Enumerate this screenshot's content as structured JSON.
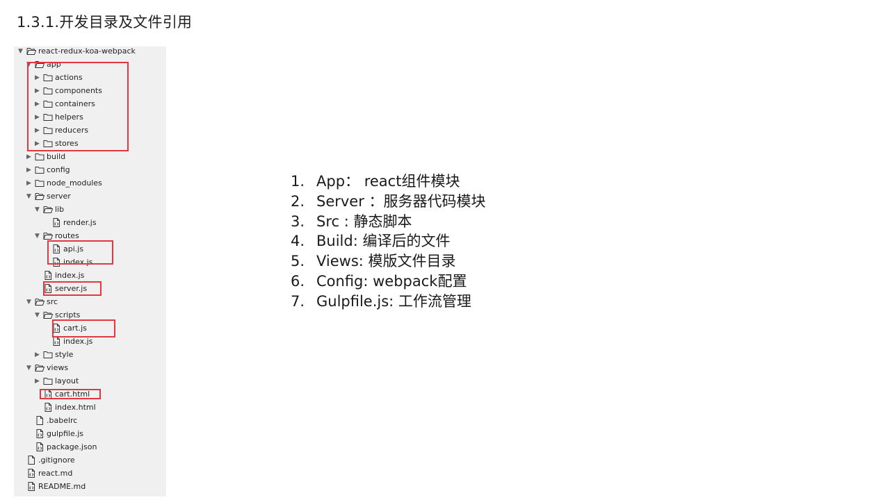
{
  "heading": "1.3.1.开发目录及文件引用",
  "tree": [
    {
      "label": "react-redux-koa-webpack",
      "type": "folder",
      "state": "open",
      "depth": 0
    },
    {
      "label": "app",
      "type": "folder",
      "state": "open",
      "depth": 1
    },
    {
      "label": "actions",
      "type": "folder",
      "state": "closed",
      "depth": 2
    },
    {
      "label": "components",
      "type": "folder",
      "state": "closed",
      "depth": 2
    },
    {
      "label": "containers",
      "type": "folder",
      "state": "closed",
      "depth": 2
    },
    {
      "label": "helpers",
      "type": "folder",
      "state": "closed",
      "depth": 2
    },
    {
      "label": "reducers",
      "type": "folder",
      "state": "closed",
      "depth": 2
    },
    {
      "label": "stores",
      "type": "folder",
      "state": "closed",
      "depth": 2
    },
    {
      "label": "build",
      "type": "folder",
      "state": "closed",
      "depth": 1
    },
    {
      "label": "config",
      "type": "folder",
      "state": "closed",
      "depth": 1
    },
    {
      "label": "node_modules",
      "type": "folder",
      "state": "closed",
      "depth": 1
    },
    {
      "label": "server",
      "type": "folder",
      "state": "open",
      "depth": 1
    },
    {
      "label": "lib",
      "type": "folder",
      "state": "open",
      "depth": 2
    },
    {
      "label": "render.js",
      "type": "code",
      "depth": 3
    },
    {
      "label": "routes",
      "type": "folder",
      "state": "open",
      "depth": 2
    },
    {
      "label": "api.js",
      "type": "code",
      "depth": 3
    },
    {
      "label": "index.js",
      "type": "code",
      "depth": 3
    },
    {
      "label": "index.js",
      "type": "code",
      "depth": 2
    },
    {
      "label": "server.js",
      "type": "code",
      "depth": 2
    },
    {
      "label": "src",
      "type": "folder",
      "state": "open",
      "depth": 1
    },
    {
      "label": "scripts",
      "type": "folder",
      "state": "open",
      "depth": 2
    },
    {
      "label": "cart.js",
      "type": "code",
      "depth": 3
    },
    {
      "label": "index.js",
      "type": "code",
      "depth": 3
    },
    {
      "label": "style",
      "type": "folder",
      "state": "closed",
      "depth": 2
    },
    {
      "label": "views",
      "type": "folder",
      "state": "open",
      "depth": 1
    },
    {
      "label": "layout",
      "type": "folder",
      "state": "closed",
      "depth": 2
    },
    {
      "label": "cart.html",
      "type": "code",
      "depth": 2
    },
    {
      "label": "index.html",
      "type": "code",
      "depth": 2
    },
    {
      "label": ".babelrc",
      "type": "file",
      "depth": 1
    },
    {
      "label": "gulpfile.js",
      "type": "code",
      "depth": 1
    },
    {
      "label": "package.json",
      "type": "code",
      "depth": 1
    },
    {
      "label": ".gitignore",
      "type": "file",
      "depth": 0
    },
    {
      "label": "react.md",
      "type": "code",
      "depth": 0
    },
    {
      "label": "README.md",
      "type": "code",
      "depth": 0
    }
  ],
  "highlight_color": "#e0383e",
  "list": [
    {
      "num": "1.",
      "text": "App：  react组件模块"
    },
    {
      "num": "2.",
      "text": "Server ：服务器代码模块"
    },
    {
      "num": "3.",
      "text": "Src : 静态脚本"
    },
    {
      "num": "4.",
      "text": "Build: 编译后的文件"
    },
    {
      "num": "5.",
      "text": "Views: 模版文件目录"
    },
    {
      "num": "6.",
      "text": "Config: webpack配置"
    },
    {
      "num": "7.",
      "text": "Gulpfile.js: 工作流管理"
    }
  ]
}
